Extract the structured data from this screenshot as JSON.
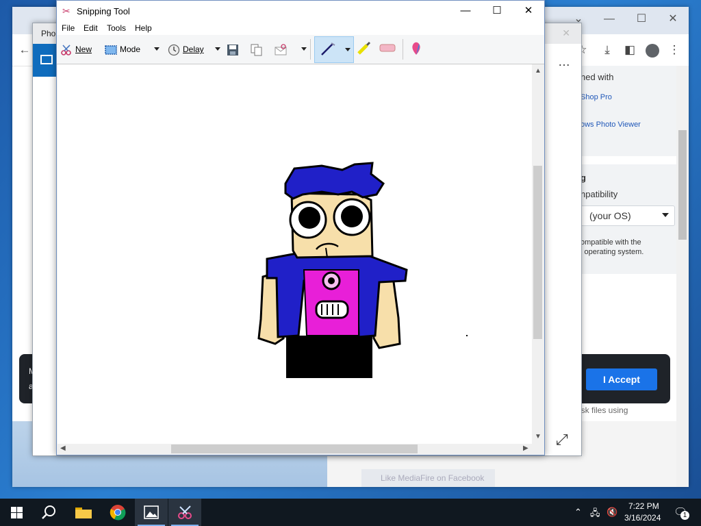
{
  "chrome": {
    "right_panel": {
      "opened_with": "ned with",
      "shop_pro": "Shop Pro",
      "photo_viewer": "ows Photo Viewer",
      "section_title": "g",
      "compatibility": "npatibility",
      "os_select_value": "(your OS)",
      "compat_note_line1": "ompatible with the",
      "compat_note_line2": "l operating system."
    },
    "cookie": {
      "left_text_1": "M",
      "left_text_2": "a",
      "accept_label": "I Accept",
      "below_text": "isk files using"
    },
    "facebook_text": "Like MediaFire on Facebook"
  },
  "photos": {
    "tab_label": "Pho"
  },
  "snipping_tool": {
    "title": "Snipping Tool",
    "menu": [
      "File",
      "Edit",
      "Tools",
      "Help"
    ],
    "toolbar": {
      "new_label": "New",
      "mode_label": "Mode",
      "delay_label": "Delay"
    }
  },
  "taskbar": {
    "time": "7:22 PM",
    "date": "3/16/2024",
    "notification_count": "1"
  },
  "colors": {
    "accent_blue": "#1a73e8",
    "hair_blue": "#2020c8",
    "shirt_pink": "#e81fd8",
    "skin": "#f7dfaa"
  }
}
